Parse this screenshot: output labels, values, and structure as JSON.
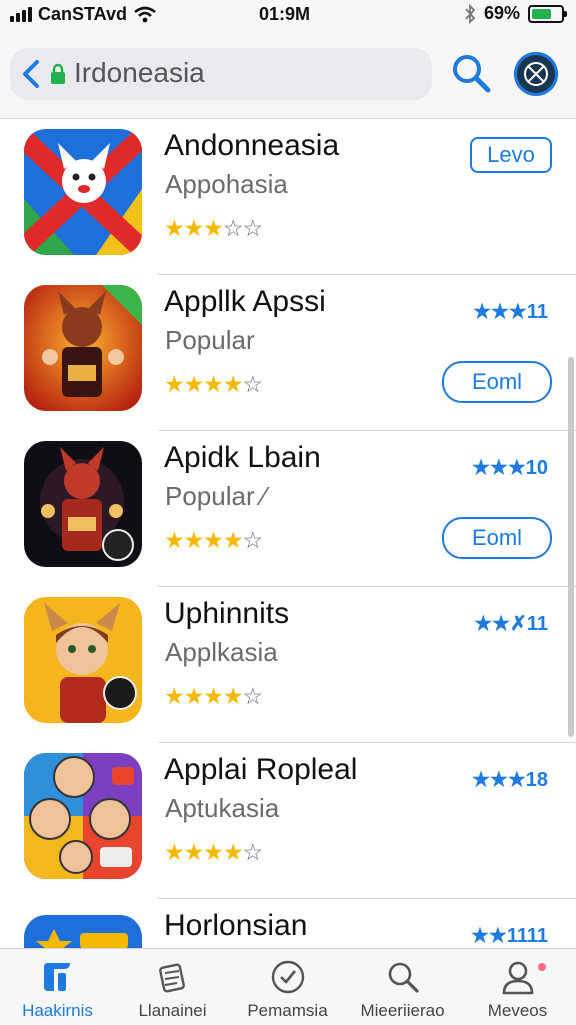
{
  "status_bar": {
    "carrier": "CanSTAvd",
    "time": "01:9M",
    "battery": "69%",
    "battery_level": 0.69,
    "icons": [
      "signal-icon",
      "wifi-icon",
      "bluetooth-icon",
      "battery-icon"
    ]
  },
  "header": {
    "url_text": "Irdoneasia",
    "icons": [
      "back-arrow-icon",
      "lock-icon",
      "search-icon",
      "avatar-icon"
    ]
  },
  "apps": [
    {
      "title": "Andonneasia",
      "subtitle": "Appohasia",
      "rating": 3,
      "rating_count": "",
      "button_label": "Levo"
    },
    {
      "title": "Appllk Apssi",
      "subtitle": "Popular",
      "rating": 4,
      "rating_count": "★★★11",
      "button_label": "Eoml"
    },
    {
      "title": "Apidk Lbain",
      "subtitle": "Popular ⁄",
      "rating": 4,
      "rating_count": "★★★10",
      "button_label": "Eoml"
    },
    {
      "title": "Uphinnits",
      "subtitle": "Applkasia",
      "rating": 4,
      "rating_count": "★★✗11",
      "button_label": ""
    },
    {
      "title": "Applai Ropleal",
      "subtitle": "Aptukasia",
      "rating": 4,
      "rating_count": "★★★18",
      "button_label": ""
    },
    {
      "title": "Horlonsian",
      "subtitle": "",
      "rating": 0,
      "rating_count": "★★1111",
      "button_label": ""
    }
  ],
  "tab_bar": {
    "tabs": [
      {
        "label": "Haakirnis",
        "icon": "home-tab-icon",
        "active": true
      },
      {
        "label": "Llanainei",
        "icon": "stack-tab-icon",
        "active": false
      },
      {
        "label": "Pemamsia",
        "icon": "explore-tab-icon",
        "active": false
      },
      {
        "label": "Mieeriierao",
        "icon": "search-tab-icon",
        "active": false
      },
      {
        "label": "Meveos",
        "icon": "profile-tab-icon",
        "active": false
      }
    ]
  },
  "colors": {
    "accent": "#1d7be0",
    "star": "#f5b800",
    "lock": "#22b14c"
  }
}
